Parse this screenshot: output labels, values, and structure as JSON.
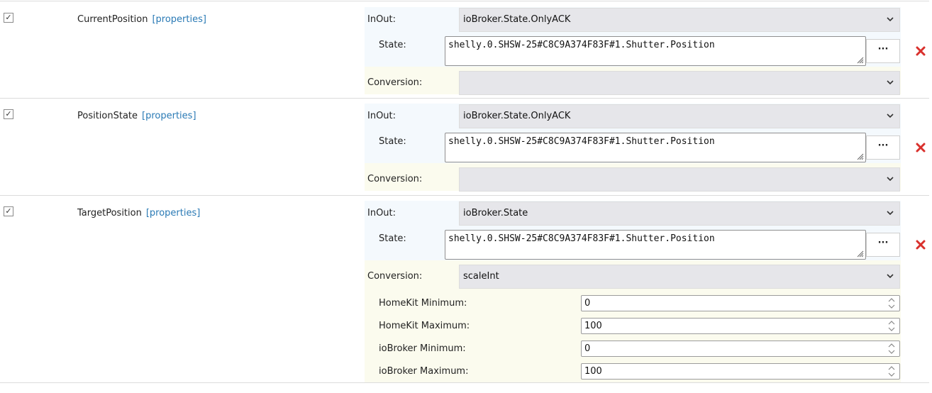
{
  "labels": {
    "inout": "InOut:",
    "state": "State:",
    "conversion": "Conversion:",
    "properties": "[properties]",
    "dots": "···"
  },
  "rows": [
    {
      "checked": true,
      "name": "CurrentPosition",
      "inout": "ioBroker.State.OnlyACK",
      "state": "shelly.0.SHSW-25#C8C9A374F83F#1.Shutter.Position",
      "conversion": ""
    },
    {
      "checked": true,
      "name": "PositionState",
      "inout": "ioBroker.State.OnlyACK",
      "state": "shelly.0.SHSW-25#C8C9A374F83F#1.Shutter.Position",
      "conversion": ""
    },
    {
      "checked": true,
      "name": "TargetPosition",
      "inout": "ioBroker.State",
      "state": "shelly.0.SHSW-25#C8C9A374F83F#1.Shutter.Position",
      "conversion": "scaleInt",
      "params": [
        {
          "label": "HomeKit Minimum:",
          "value": "0"
        },
        {
          "label": "HomeKit Maximum:",
          "value": "100"
        },
        {
          "label": "ioBroker Minimum:",
          "value": "0"
        },
        {
          "label": "ioBroker Maximum:",
          "value": "100"
        }
      ]
    }
  ],
  "colors": {
    "delete": "#d9302c",
    "link": "#2a7ab5"
  }
}
